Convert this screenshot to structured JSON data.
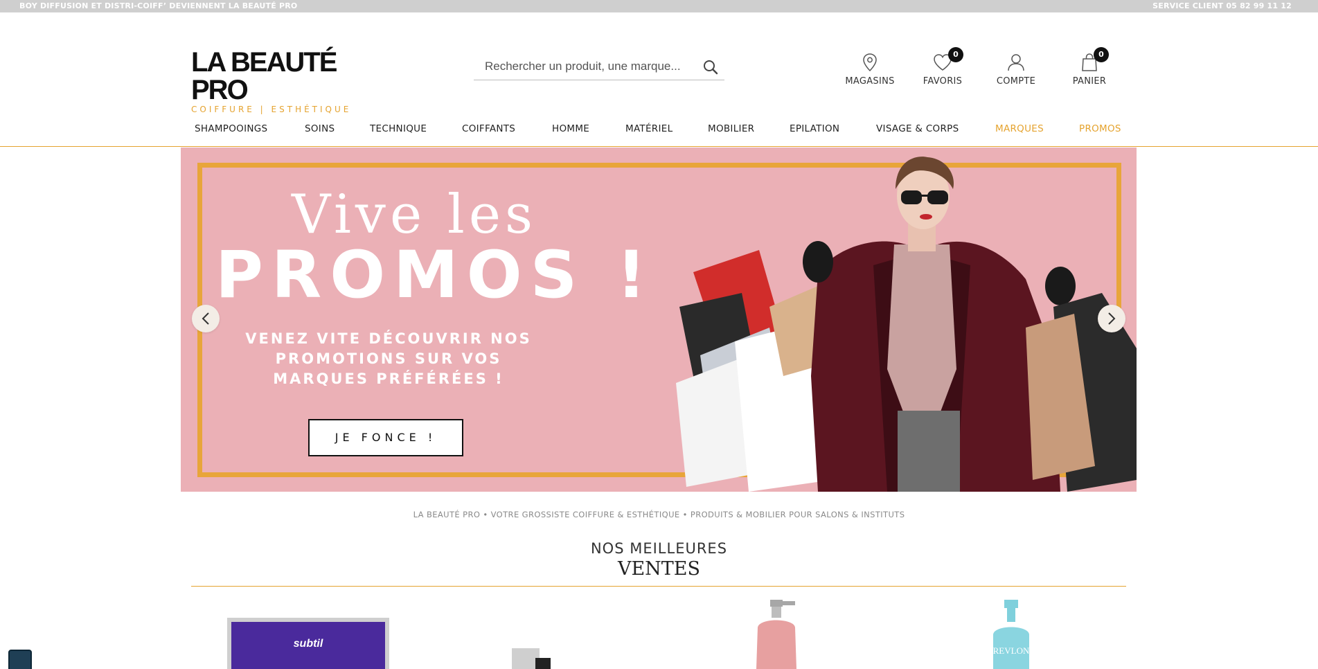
{
  "topbar": {
    "announcement": "BOY DIFFUSION ET DISTRI-COIFF’ DEVIENNENT LA BEAUTÉ PRO",
    "service": "SERVICE CLIENT 05 82 99 11 12"
  },
  "logo": {
    "wordmark": "LA BEAUTÉ PRO",
    "tagline": "COIFFURE | ESTHÉTIQUE"
  },
  "search": {
    "placeholder": "Rechercher un produit, une marque..."
  },
  "header_icons": {
    "stores_label": "MAGASINS",
    "favorites_label": "FAVORIS",
    "favorites_count": "0",
    "account_label": "COMPTE",
    "cart_label": "PANIER",
    "cart_count": "0"
  },
  "nav": {
    "items": [
      {
        "label": "SHAMPOOINGS"
      },
      {
        "label": "SOINS"
      },
      {
        "label": "TECHNIQUE"
      },
      {
        "label": "COIFFANTS"
      },
      {
        "label": "HOMME"
      },
      {
        "label": "MATÉRIEL"
      },
      {
        "label": "MOBILIER"
      },
      {
        "label": "EPILATION"
      },
      {
        "label": "VISAGE & CORPS"
      },
      {
        "label": "MARQUES"
      },
      {
        "label": "PROMOS"
      }
    ],
    "accent_color": "#e5a32f"
  },
  "hero": {
    "line1": "Vive les",
    "line2": "PROMOS !",
    "subtitle": "VENEZ VITE DÉCOUVRIR NOS PROMOTIONS SUR VOS MARQUES PRÉFÉRÉES !",
    "cta": "JE FONCE !",
    "background_color": "#ebb0b6",
    "frame_color": "#e8a53a"
  },
  "strap": "LA BEAUTÉ PRO • VOTRE GROSSISTE COIFFURE & ESTHÉTIQUE • PRODUITS & MOBILIER POUR SALONS & INSTITUTS",
  "bestsellers": {
    "title_top": "NOS MEILLEURES",
    "title_bottom": "VENTES",
    "products": [
      {
        "brand_text": "subtil"
      },
      {
        "brand_text": ""
      },
      {
        "brand_text": ""
      },
      {
        "brand_text": "REVLON"
      }
    ]
  }
}
